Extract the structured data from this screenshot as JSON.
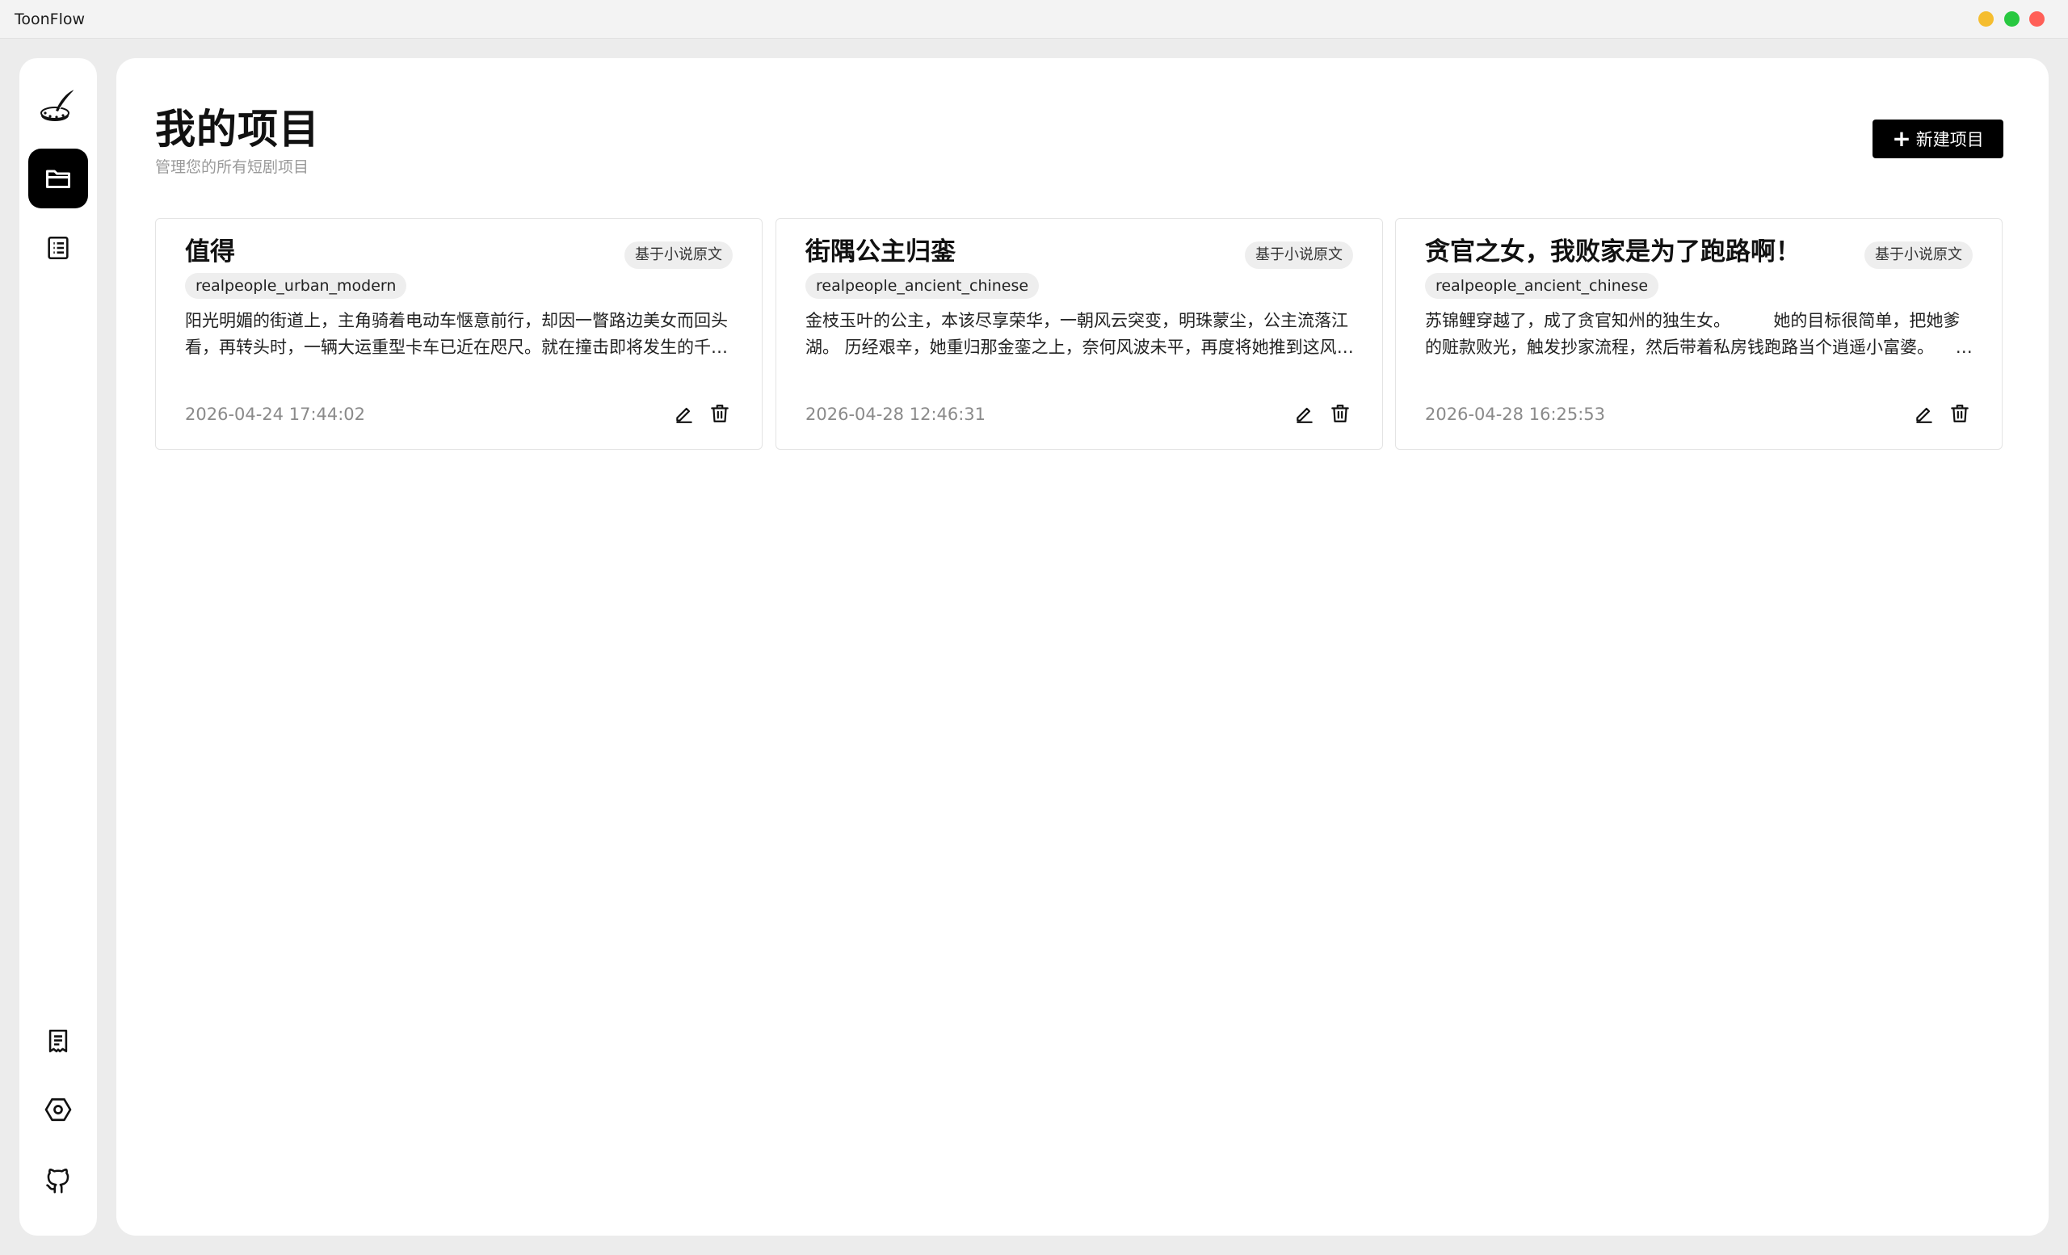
{
  "window": {
    "title": "ToonFlow",
    "controls": [
      {
        "name": "minimize",
        "color": "#f5bd2f"
      },
      {
        "name": "maximize",
        "color": "#28c840"
      },
      {
        "name": "close",
        "color": "#ff5f57"
      }
    ]
  },
  "sidebar": {
    "top_items": [
      {
        "icon": "quill-logo-icon",
        "active": false
      },
      {
        "icon": "folder-icon",
        "active": true
      },
      {
        "icon": "list-icon",
        "active": false
      }
    ],
    "bottom_items": [
      {
        "icon": "receipt-icon"
      },
      {
        "icon": "settings-hex-icon"
      },
      {
        "icon": "github-icon"
      }
    ]
  },
  "header": {
    "title": "我的项目",
    "subtitle": "管理您的所有短剧项目",
    "new_button_label": "新建项目"
  },
  "projects": [
    {
      "title": "值得",
      "source_tag": "基于小说原文",
      "style_tag": "realpeople_urban_modern",
      "description": "阳光明媚的街道上，主角骑着电动车惬意前行，却因一瞥路边美女而回头看，再转头时，一辆大运重型卡车已近在咫尺。就在撞击即将发生的千钧一发之际……",
      "date": "2026-04-24 17:44:02"
    },
    {
      "title": "街隅公主归銮",
      "source_tag": "基于小说原文",
      "style_tag": "realpeople_ancient_chinese",
      "description": "金枝玉叶的公主，本该尽享荣华，一朝风云突变，明珠蒙尘，公主流落江湖。 历经艰辛，她重归那金銮之上，奈何风波未平，再度将她推到这风口浪尖……",
      "date": "2026-04-28 12:46:31"
    },
    {
      "title": "贪官之女，我败家是为了跑路啊！",
      "source_tag": "基于小说原文",
      "style_tag": "realpeople_ancient_chinese",
      "description": "苏锦鲤穿越了，成了贪官知州的独生女。        她的目标很简单，把她爹的赃款败光，触发抄家流程，然后带着私房钱跑路当个逍遥小富婆。        ……",
      "date": "2026-04-28 16:25:53"
    }
  ]
}
